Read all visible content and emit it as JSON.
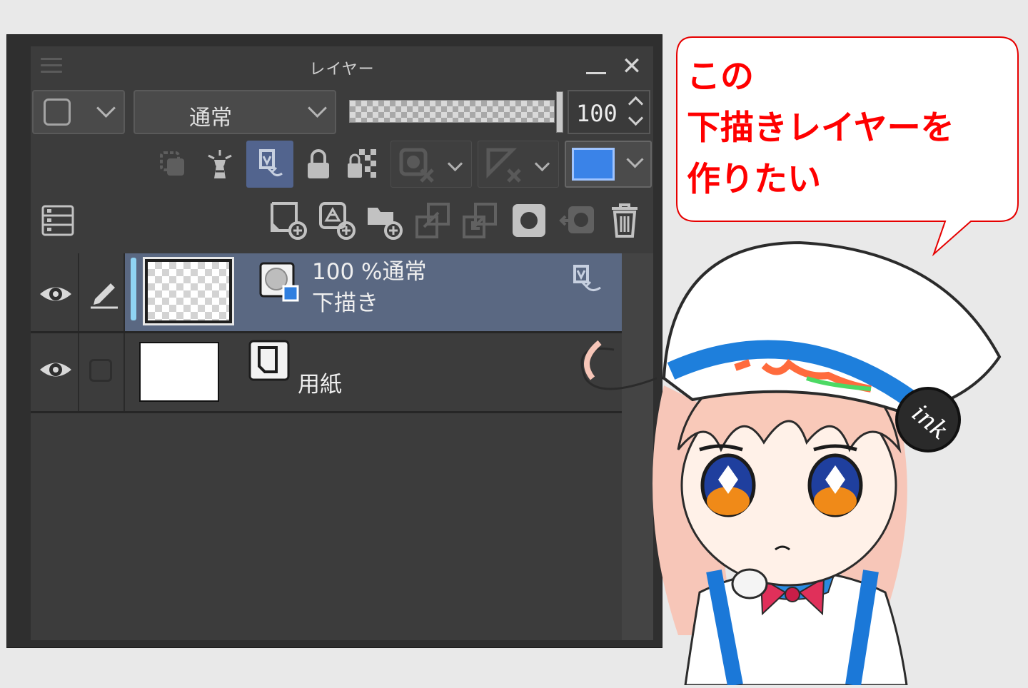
{
  "panel": {
    "title": "レイヤー",
    "blend_mode": "通常",
    "opacity_value": "100",
    "opacity_level": 1.0,
    "main_color": "#3a83e8",
    "layers": [
      {
        "opacity_blend": "100 %通常",
        "name": "下描き",
        "selected": true,
        "kind": "raster"
      },
      {
        "opacity_blend": "",
        "name": "用紙",
        "selected": false,
        "kind": "paper"
      }
    ]
  },
  "bubble": {
    "lines": [
      "この",
      "下描きレイヤーを",
      "作りたい"
    ],
    "text_color": "#ff0000",
    "border_color": "#e60000"
  },
  "character": {
    "hat_badge_text": "ink"
  }
}
